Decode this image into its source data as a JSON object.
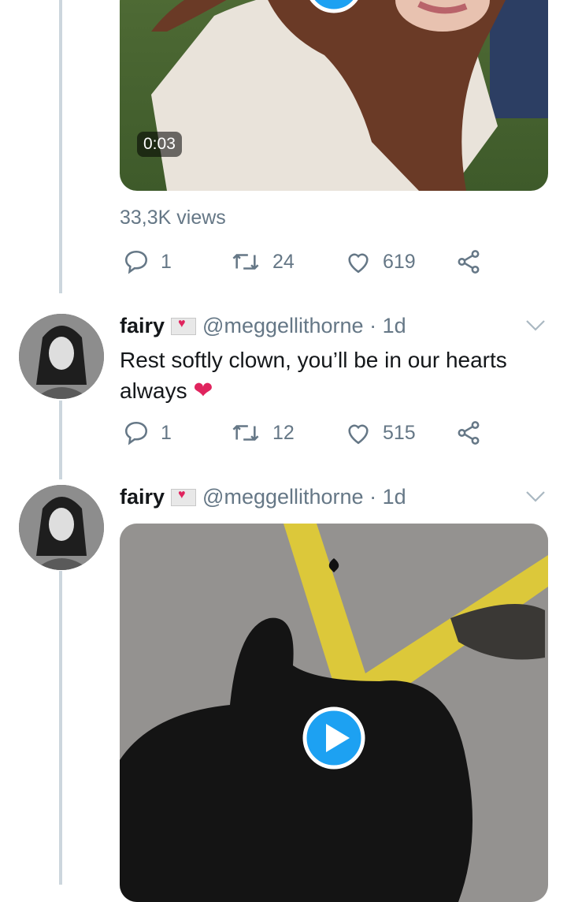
{
  "tweet1": {
    "duration": "0:03",
    "views": "33,3K views",
    "reply_count": "1",
    "retweet_count": "24",
    "like_count": "619"
  },
  "tweet2": {
    "name": "fairy",
    "handle": "@meggellithorne",
    "time": "· 1d",
    "text": "Rest softly clown, you’ll be in our hearts always",
    "emoji": "❤",
    "reply_count": "1",
    "retweet_count": "12",
    "like_count": "515"
  },
  "tweet3": {
    "name": "fairy",
    "handle": "@meggellithorne",
    "time": "· 1d"
  },
  "colors": {
    "accent": "#1da1f2",
    "muted": "#657786",
    "thread_line": "#ccd6dd",
    "like_red": "#e0245e"
  },
  "icons": [
    "reply-icon",
    "retweet-icon",
    "like-icon",
    "share-icon",
    "chevron-down-icon",
    "envelope-heart-emoji",
    "play-icon"
  ]
}
